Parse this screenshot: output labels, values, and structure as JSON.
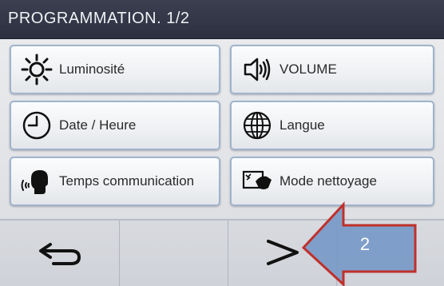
{
  "header": {
    "title": "PROGRAMMATION. 1/2"
  },
  "menu": {
    "items": [
      {
        "label": "Luminosité",
        "icon": "brightness-icon"
      },
      {
        "label": "VOLUME",
        "icon": "speaker-icon"
      },
      {
        "label": "Date / Heure",
        "icon": "clock-icon"
      },
      {
        "label": "Langue",
        "icon": "globe-icon"
      },
      {
        "label": "Temps communication",
        "icon": "talking-head-icon"
      },
      {
        "label": "Mode nettoyage",
        "icon": "cleaning-icon"
      }
    ]
  },
  "footer": {
    "back_icon": "back-arrow-icon",
    "next_icon": "next-chevron-icon"
  },
  "annotation": {
    "step_number": "2",
    "arrow_color": "#7a9cc8",
    "arrow_border_color": "#c0302b"
  },
  "colors": {
    "title_bar": "#2f3344",
    "button_border": "#9fb3cc",
    "screen_bg": "#e6e7ea"
  }
}
